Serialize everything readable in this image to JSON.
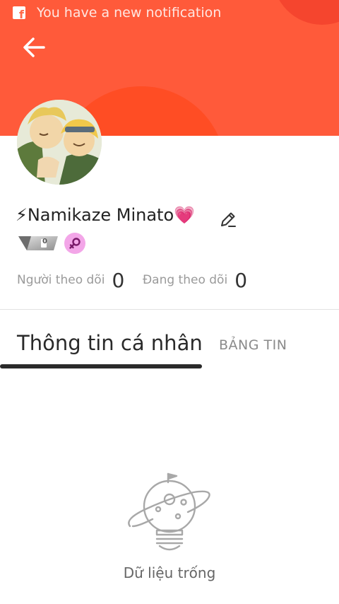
{
  "status_bar": {
    "notification_text": "You have a new notification",
    "icon": "facebook-icon"
  },
  "header": {
    "back_icon": "arrow-left-icon",
    "accent_color": "#ff5a3a"
  },
  "profile": {
    "display_name": "⚡Namikaze Minato💗",
    "edit_icon": "pencil-icon",
    "level": "0",
    "gender_icon": "female-symbol-icon"
  },
  "stats": {
    "followers_label": "Người theo dõi",
    "followers_value": "0",
    "following_label": "Đang theo dõi",
    "following_value": "0"
  },
  "tabs": [
    {
      "label": "Thông tin cá nhân",
      "active": true
    },
    {
      "label": "BẢNG TIN",
      "active": false
    }
  ],
  "empty_state": {
    "icon": "planet-lightbulb-icon",
    "text": "Dữ liệu trống"
  }
}
